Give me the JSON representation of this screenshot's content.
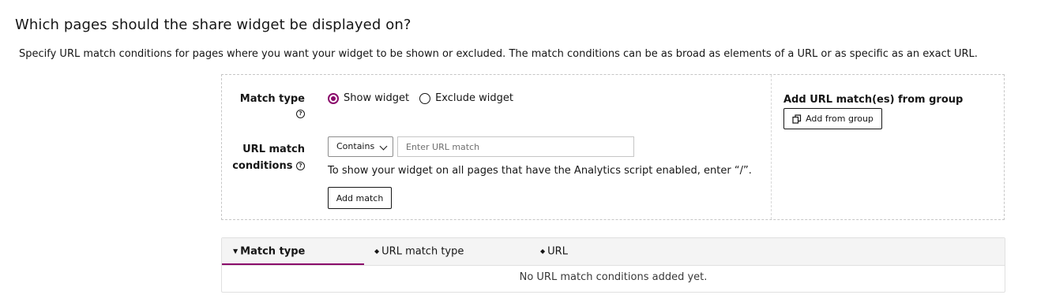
{
  "heading": "Which pages should the share widget be displayed on?",
  "description": "Specify URL match conditions for pages where you want your widget to be shown or excluded. The match conditions can be as broad as elements of a URL or as specific as an exact URL.",
  "form": {
    "match_type_label": "Match type",
    "url_conditions_label_line1": "URL match",
    "url_conditions_label_line2": "conditions",
    "radio_show": "Show widget",
    "radio_exclude": "Exclude widget",
    "selected_radio": "Show widget",
    "select_value": "Contains",
    "url_placeholder": "Enter URL match",
    "url_value": "",
    "hint": "To show your widget on all pages that have the Analytics script enabled, enter “/”.",
    "add_match_label": "Add match"
  },
  "group": {
    "title": "Add URL match(es) from group",
    "button_label": "Add from group"
  },
  "table": {
    "columns": [
      "Match type",
      "URL match type",
      "URL"
    ],
    "active_sort_column": "Match type",
    "empty_message": "No URL match conditions added yet."
  },
  "colors": {
    "accent": "#8a0a6b"
  }
}
